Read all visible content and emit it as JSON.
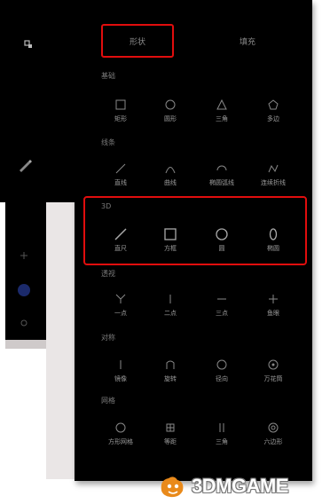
{
  "tabs": [
    {
      "label": "形状",
      "active": true
    },
    {
      "label": "填充",
      "active": false
    }
  ],
  "sections": [
    {
      "title": "基础",
      "items": [
        {
          "label": "矩形",
          "icon": "rect-icon"
        },
        {
          "label": "圆形",
          "icon": "circle-icon"
        },
        {
          "label": "三角",
          "icon": "triangle-icon"
        },
        {
          "label": "多边",
          "icon": "polygon-icon"
        }
      ]
    },
    {
      "title": "线条",
      "items": [
        {
          "label": "直线",
          "icon": "line-icon"
        },
        {
          "label": "曲线",
          "icon": "curve-icon"
        },
        {
          "label": "椭圆弧线",
          "icon": "arc-icon"
        },
        {
          "label": "连续折线",
          "icon": "polyline-icon"
        }
      ]
    },
    {
      "title": "3D",
      "items": [
        {
          "label": "直尺",
          "icon": "ruler-icon"
        },
        {
          "label": "方框",
          "icon": "square-icon"
        },
        {
          "label": "圆",
          "icon": "circle-outline-icon"
        },
        {
          "label": "椭圆",
          "icon": "ellipse-icon"
        }
      ]
    },
    {
      "title": "透视",
      "items": [
        {
          "label": "一点",
          "icon": "one-point-icon"
        },
        {
          "label": "二点",
          "icon": "two-point-icon"
        },
        {
          "label": "三点",
          "icon": "three-point-icon"
        },
        {
          "label": "鱼眼",
          "icon": "fisheye-icon"
        }
      ]
    },
    {
      "title": "对称",
      "items": [
        {
          "label": "镜像",
          "icon": "mirror-icon"
        },
        {
          "label": "旋转",
          "icon": "rotate-icon"
        },
        {
          "label": "径向",
          "icon": "radial-icon"
        },
        {
          "label": "万花筒",
          "icon": "kaleidoscope-icon"
        }
      ]
    },
    {
      "title": "网格",
      "items": [
        {
          "label": "方形网格",
          "icon": "grid-icon"
        },
        {
          "label": "等距",
          "icon": "isometric-icon"
        },
        {
          "label": "三角",
          "icon": "tri-grid-icon"
        },
        {
          "label": "六边形",
          "icon": "hex-grid-icon"
        }
      ]
    }
  ],
  "left_toolbar": {
    "icons": [
      "brush-size-icon",
      "pen-icon",
      "plus-icon",
      "color-dot-icon",
      "eye-icon"
    ],
    "color": "#1b2a6b"
  },
  "watermark": {
    "text": "3DMGAME",
    "accent": "#e98a1b"
  },
  "highlight_color": "#e10d0d"
}
